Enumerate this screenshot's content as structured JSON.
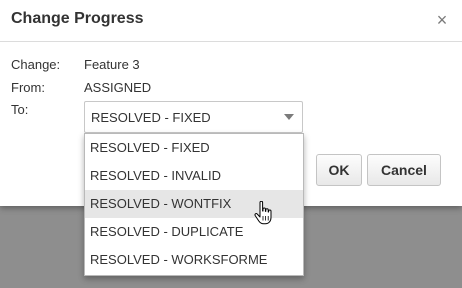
{
  "dialog": {
    "title": "Change Progress",
    "close_icon": "×",
    "fields": [
      {
        "label": "Change:",
        "value": "Feature 3"
      },
      {
        "label": "From:",
        "value": "ASSIGNED"
      },
      {
        "label": "To:"
      }
    ],
    "select": {
      "value": "RESOLVED - FIXED",
      "caret_icon": "chevron-down-icon",
      "options": [
        "RESOLVED - FIXED",
        "RESOLVED - INVALID",
        "RESOLVED - WONTFIX",
        "RESOLVED - DUPLICATE",
        "RESOLVED - WORKSFORME"
      ],
      "hovered_option": "RESOLVED - WONTFIX"
    },
    "buttons": {
      "ok": "OK",
      "cancel": "Cancel"
    }
  },
  "colors": {
    "backdrop": "#8e8e8e",
    "dialog_bg": "#ffffff",
    "text": "#333333",
    "hover_bg": "#e6e6e6"
  }
}
